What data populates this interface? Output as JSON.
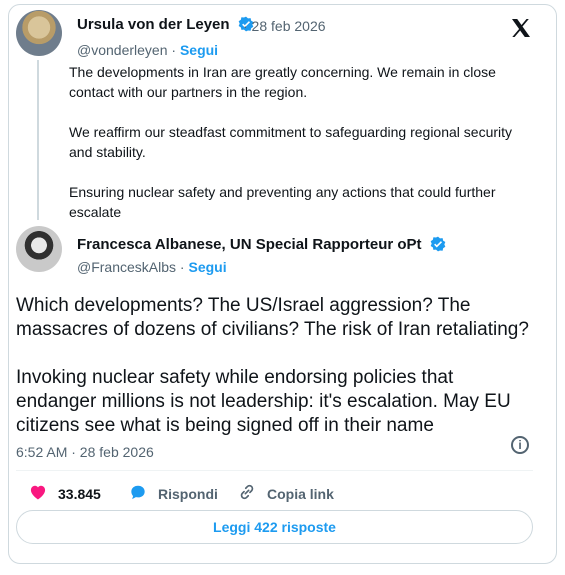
{
  "original": {
    "author_name": "Ursula von der Leyen",
    "date": "· 28 feb 2026",
    "handle": "@vonderleyen",
    "follow_label": "Segui",
    "paragraphs": [
      "The developments in Iran are greatly concerning. We remain in close contact with our partners in the region.",
      "We reaffirm our steadfast commitment to safeguarding regional security and stability.",
      "Ensuring nuclear safety and preventing any actions that could further escalate"
    ]
  },
  "reply": {
    "author_name": "Francesca Albanese, UN Special Rapporteur oPt",
    "handle": "@FranceskAlbs",
    "follow_label": "Segui",
    "paragraphs": [
      "Which developments? The US/Israel aggression? The massacres of dozens of civilians? The risk of Iran retaliating?",
      "Invoking nuclear safety while endorsing policies that endanger millions is not leadership: it's escalation. May EU citizens see what is being signed off in their name"
    ],
    "timestamp": "6:52 AM · 28 feb 2026"
  },
  "actions": {
    "likes": "33.845",
    "reply_label": "Rispondi",
    "copy_label": "Copia link"
  },
  "read_replies_label": "Leggi 422 risposte",
  "colors": {
    "accent": "#1d9bf0",
    "like": "#f91880",
    "text": "#0f1419",
    "muted": "#536471"
  },
  "icons": [
    "verified-badge-icon",
    "x-logo-icon",
    "info-icon",
    "heart-icon",
    "reply-bubble-icon",
    "link-icon"
  ]
}
